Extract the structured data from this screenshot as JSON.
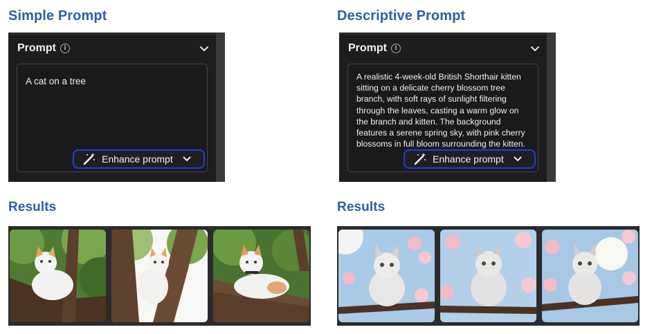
{
  "left": {
    "heading": "Simple Prompt",
    "panel": {
      "title": "Prompt",
      "prompt_text": "A cat on a tree",
      "enhance_label": "Enhance prompt"
    },
    "results_heading": "Results"
  },
  "right": {
    "heading": "Descriptive Prompt",
    "panel": {
      "title": "Prompt",
      "prompt_text": "A realistic 4-week-old British Shorthair kitten sitting on a delicate cherry blossom tree branch, with soft rays of sunlight filtering through the leaves, casting a warm glow on the branch and kitten. The background features a serene spring sky, with pink cherry blossoms in full bloom surrounding the kitten.",
      "enhance_label": "Enhance prompt"
    },
    "results_heading": "Results"
  },
  "icons": {
    "info": "info-icon",
    "collapse": "chevron-down-icon",
    "wand": "magic-wand-icon"
  },
  "colors": {
    "heading": "#2f5da8",
    "panel_bg": "#1d1d1f",
    "enhance_border": "#1f3fd3"
  }
}
